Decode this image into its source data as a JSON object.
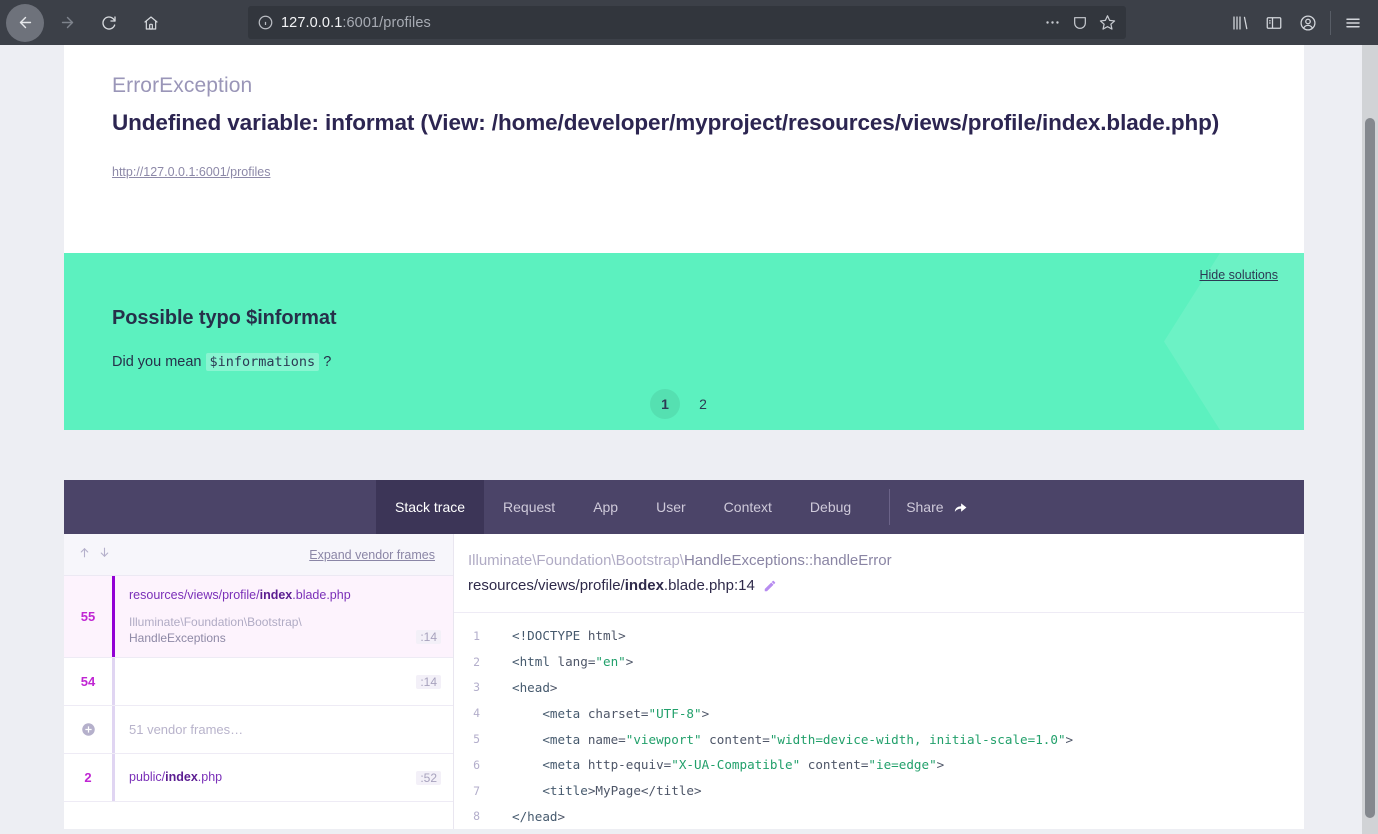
{
  "browser": {
    "back_label": "Back",
    "forward_label": "Forward",
    "reload_label": "Reload",
    "home_label": "Home",
    "url_host": "127.0.0.1",
    "url_rest": ":6001/profiles",
    "page_actions_label": "Page actions",
    "reader_label": "Reader view",
    "bookmark_label": "Bookmark this page",
    "library_label": "Library",
    "sidebar_label": "Sidebars",
    "account_label": "Account",
    "menu_label": "Open application menu"
  },
  "exception": {
    "class": "ErrorException",
    "message": "Undefined variable: informat (View: /home/developer/myproject/resources/views/profile/index.blade.php)",
    "url": "http://127.0.0.1:6001/profiles"
  },
  "solution": {
    "hide_label": "Hide solutions",
    "title": "Possible typo $informat",
    "text_before": "Did you mean",
    "code": "$informations",
    "text_after": "?",
    "pages": [
      "1",
      "2"
    ],
    "active_page": "1",
    "accent_color": "#5cf1bf"
  },
  "tabs": {
    "items": [
      {
        "label": "Stack trace",
        "active": true
      },
      {
        "label": "Request",
        "active": false
      },
      {
        "label": "App",
        "active": false
      },
      {
        "label": "User",
        "active": false
      },
      {
        "label": "Context",
        "active": false
      },
      {
        "label": "Debug",
        "active": false
      }
    ],
    "share_label": "Share"
  },
  "frames": {
    "expand_label": "Expand vendor frames",
    "sort_up": "↑",
    "sort_down": "↓",
    "items": [
      {
        "num": "55",
        "file_path": "resources/views/profile/",
        "file_bold": "index",
        "file_ext": ".blade.php",
        "class_line1": "Illuminate\\Foundation\\Bootstrap\\",
        "class_line2": "HandleExceptions",
        "line": ":14",
        "active": true
      },
      {
        "num": "54",
        "file_path": "",
        "file_bold": "",
        "file_ext": "",
        "class_line1": "",
        "class_line2": "",
        "line": ":14",
        "active": false
      },
      {
        "num": "",
        "vendor_label": "51 vendor frames…",
        "is_vendor": true,
        "line": ""
      },
      {
        "num": "2",
        "file_path": "public/",
        "file_bold": "index",
        "file_ext": ".php",
        "class_line1": "",
        "class_line2": "",
        "line": ":52",
        "active": false
      }
    ]
  },
  "code": {
    "class_namespace": "Illuminate\\Foundation\\Bootstrap\\",
    "class_name": "HandleExceptions::handleError",
    "file_path": "resources/views/profile/",
    "file_bold": "index",
    "file_ext": ".blade.php:14",
    "edit_label": "Open in editor",
    "lines": [
      {
        "n": "1",
        "src": "<!DOCTYPE html>"
      },
      {
        "n": "2",
        "src": "<html lang=\"en\">"
      },
      {
        "n": "3",
        "src": "<head>"
      },
      {
        "n": "4",
        "src": "    <meta charset=\"UTF-8\">"
      },
      {
        "n": "5",
        "src": "    <meta name=\"viewport\" content=\"width=device-width, initial-scale=1.0\">"
      },
      {
        "n": "6",
        "src": "    <meta http-equiv=\"X-UA-Compatible\" content=\"ie=edge\">"
      },
      {
        "n": "7",
        "src": "    <title>MyPage</title>"
      },
      {
        "n": "8",
        "src": "</head>"
      }
    ]
  }
}
